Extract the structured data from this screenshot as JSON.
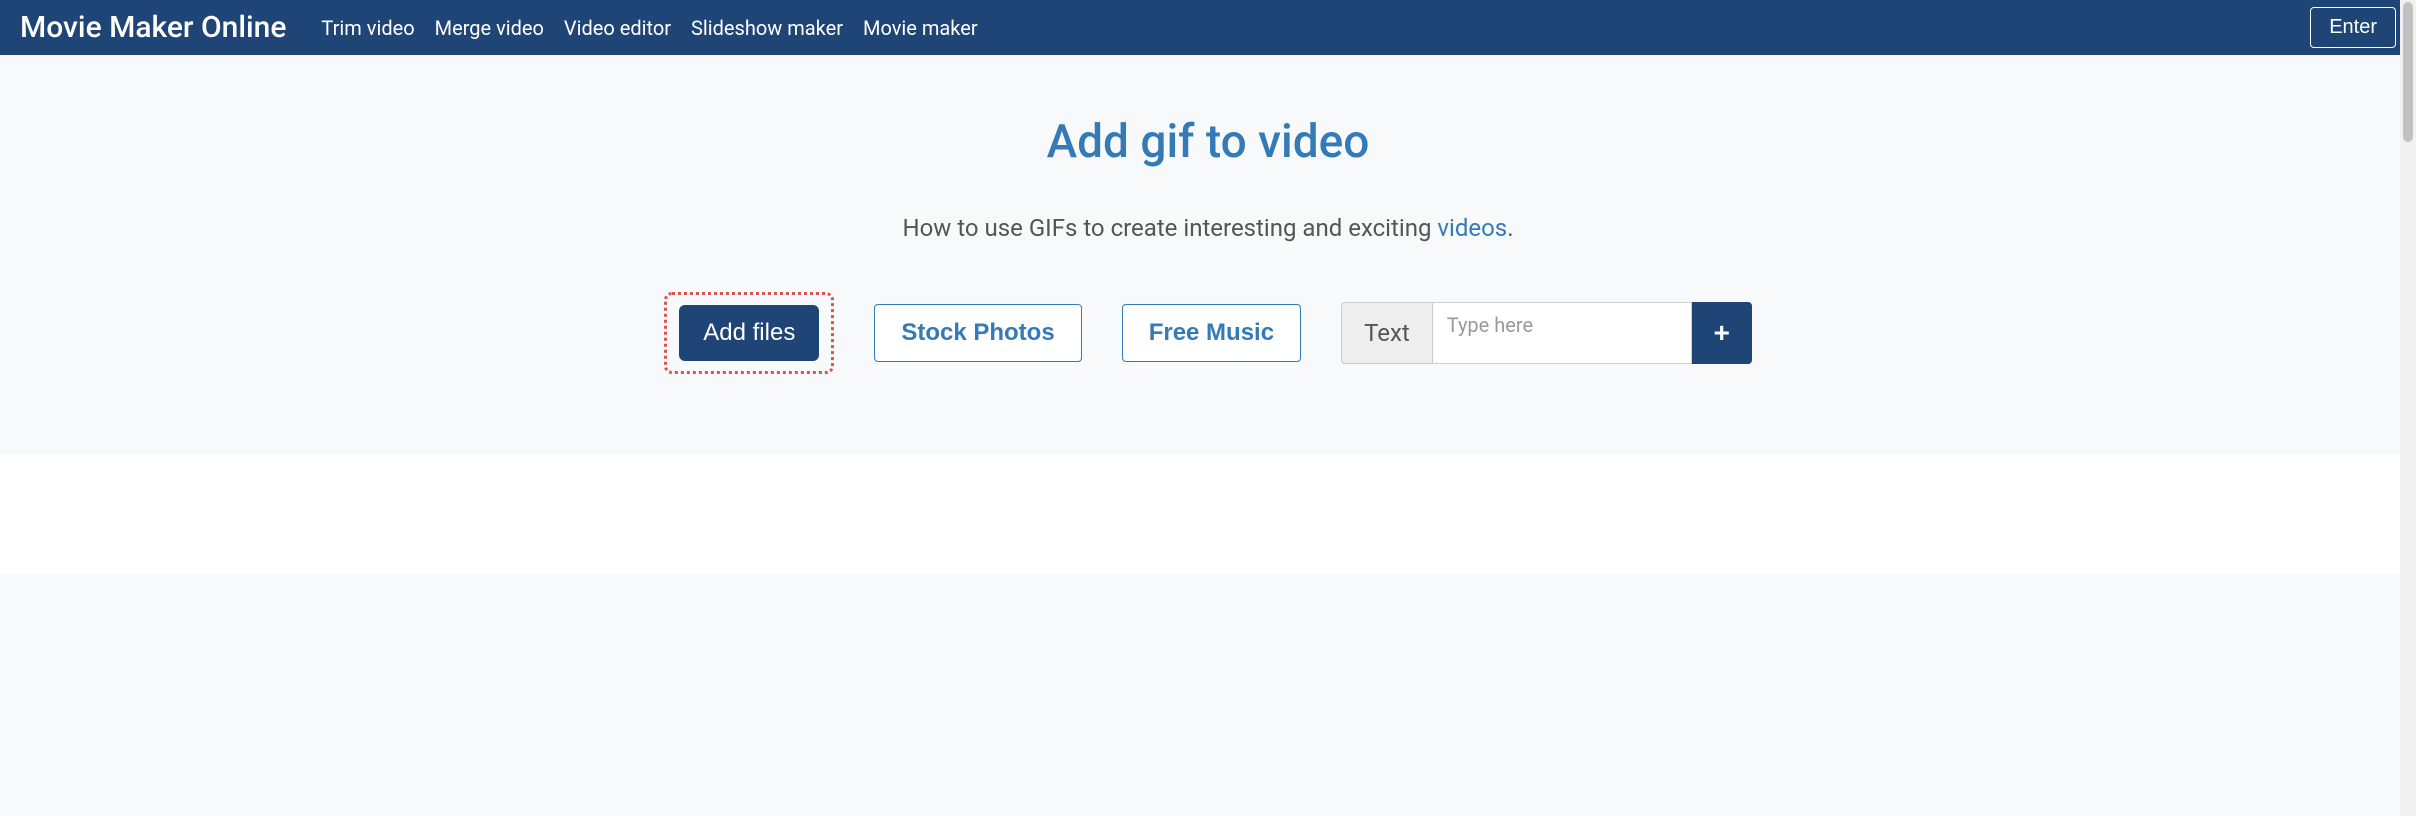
{
  "navbar": {
    "brand": "Movie Maker Online",
    "links": [
      "Trim video",
      "Merge video",
      "Video editor",
      "Slideshow maker",
      "Movie maker"
    ],
    "enter": "Enter"
  },
  "page": {
    "title": "Add gif to video",
    "subtitle_prefix": "How to use GIFs to create interesting and exciting ",
    "subtitle_link": "videos",
    "subtitle_suffix": "."
  },
  "toolbar": {
    "add_files": "Add files",
    "stock_photos": "Stock Photos",
    "free_music": "Free Music",
    "text_label": "Text",
    "text_placeholder": "Type here",
    "add_text_icon": "+"
  }
}
